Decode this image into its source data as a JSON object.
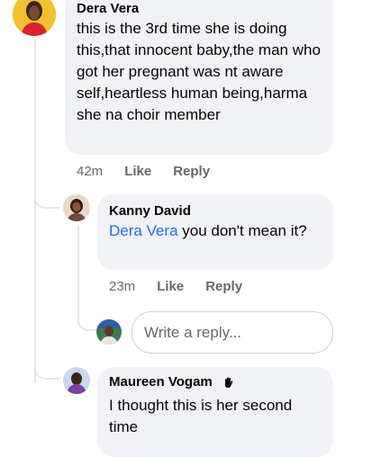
{
  "comments": [
    {
      "author": "Dera Vera",
      "text": "this is the 3rd time she is doing this,that innocent baby,the man who got her pregnant was nt aware self,heartless human being,harma she na choir member",
      "time": "42m",
      "like_label": "Like",
      "reply_label": "Reply"
    },
    {
      "author": "Kanny David",
      "mention": "Dera Vera",
      "text": " you don't mean it?",
      "time": "23m",
      "like_label": "Like",
      "reply_label": "Reply"
    },
    {
      "author": "Maureen Vogam",
      "badge_icon": "waving-hand-icon",
      "text": "I thought this is her second time"
    }
  ],
  "reply_input": {
    "placeholder": "Write a reply..."
  },
  "colors": {
    "bubble": "#f0f2f5",
    "mention": "#216fdb",
    "meta": "#65676b"
  }
}
